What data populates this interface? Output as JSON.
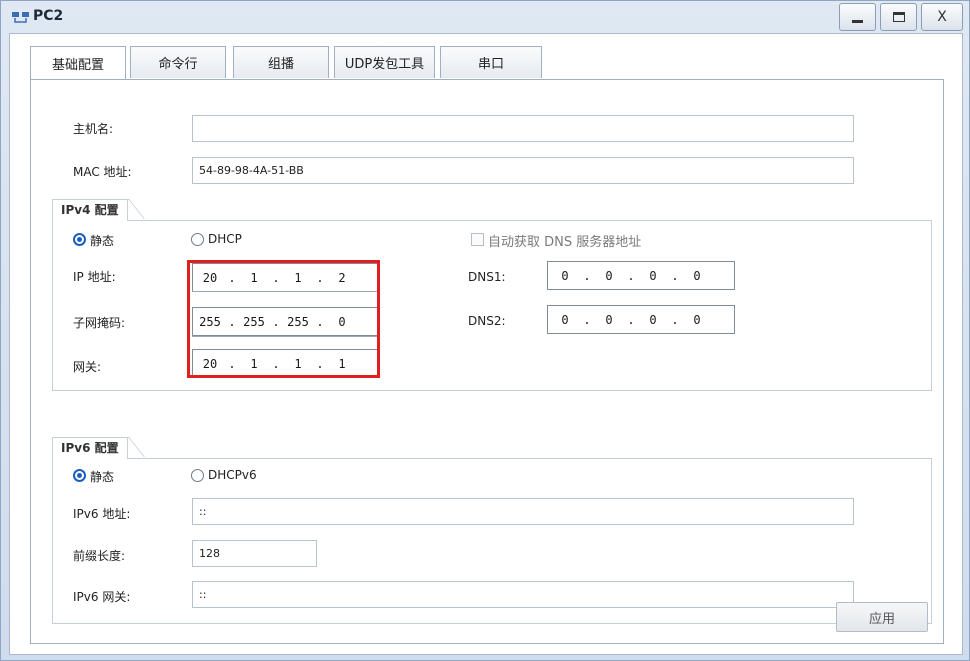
{
  "window": {
    "title": "PC2"
  },
  "tabs": [
    {
      "label": "基础配置",
      "active": true
    },
    {
      "label": "命令行"
    },
    {
      "label": "组播"
    },
    {
      "label": "UDP发包工具"
    },
    {
      "label": "串口"
    }
  ],
  "basic": {
    "hostname_label": "主机名:",
    "hostname_value": "",
    "mac_label": "MAC 地址:",
    "mac_value": "54-89-98-4A-51-BB"
  },
  "ipv4": {
    "title": "IPv4 配置",
    "static_label": "静态",
    "dhcp_label": "DHCP",
    "selected": "静态",
    "auto_dns_label": "自动获取 DNS 服务器地址",
    "ip_label": "IP 地址:",
    "mask_label": "子网掩码:",
    "gateway_label": "网关:",
    "ip": [
      "20",
      "1",
      "1",
      "2"
    ],
    "mask": [
      "255",
      "255",
      "255",
      "0"
    ],
    "gateway": [
      "20",
      "1",
      "1",
      "1"
    ],
    "dns1_label": "DNS1:",
    "dns2_label": "DNS2:",
    "dns1": [
      "0",
      "0",
      "0",
      "0"
    ],
    "dns2": [
      "0",
      "0",
      "0",
      "0"
    ]
  },
  "ipv6": {
    "title": "IPv6 配置",
    "static_label": "静态",
    "dhcp_label": "DHCPv6",
    "selected": "静态",
    "address_label": "IPv6 地址:",
    "address_value": "::",
    "prefix_label": "前缀长度:",
    "prefix_value": "128",
    "gateway_label": "IPv6 网关:",
    "gateway_value": "::"
  },
  "apply_label": "应用",
  "colors": {
    "highlight": "#e02020",
    "radio": "#1a5fbf"
  }
}
